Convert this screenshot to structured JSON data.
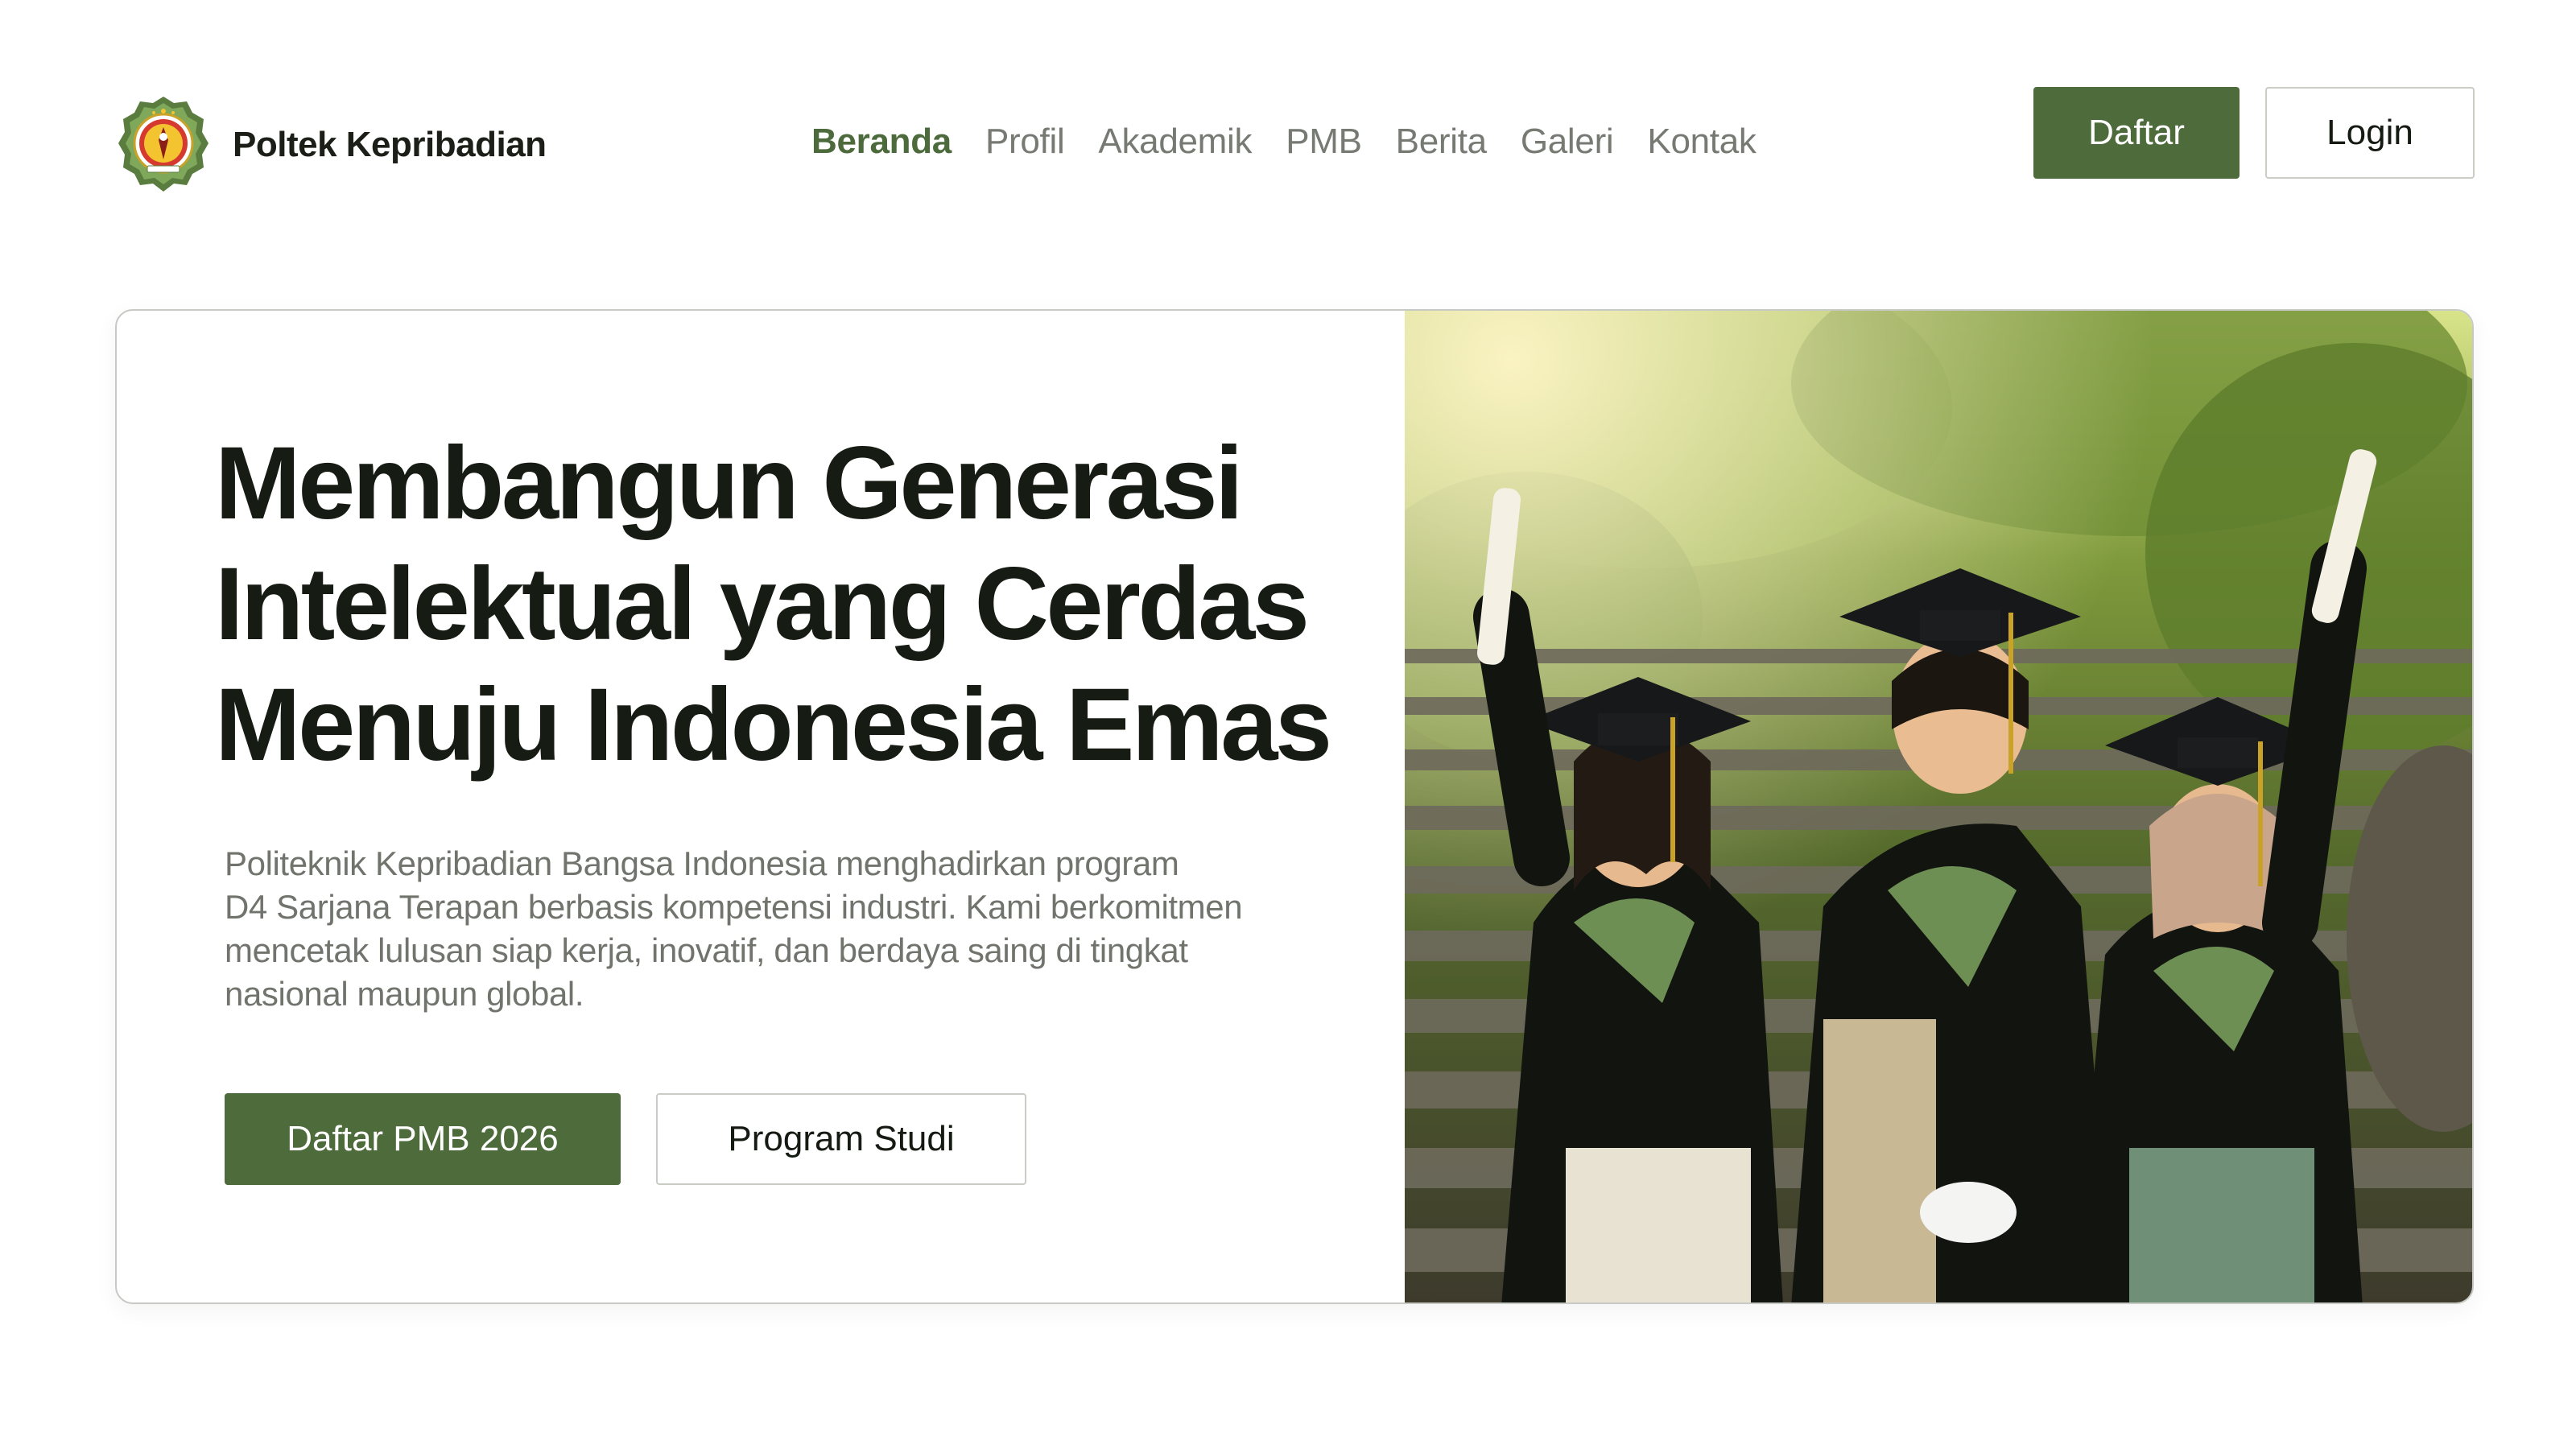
{
  "header": {
    "brand_name": "Poltek Kepribadian",
    "logo_icon": "institution-crest-icon",
    "nav": [
      {
        "label": "Beranda",
        "active": true
      },
      {
        "label": "Profil",
        "active": false
      },
      {
        "label": "Akademik",
        "active": false
      },
      {
        "label": "PMB",
        "active": false
      },
      {
        "label": "Berita",
        "active": false
      },
      {
        "label": "Galeri",
        "active": false
      },
      {
        "label": "Kontak",
        "active": false
      }
    ],
    "register_label": "Daftar",
    "login_label": "Login"
  },
  "hero": {
    "headline_lines": [
      "Membangun Generasi",
      "Intelektual yang Cerdas",
      "Menuju Indonesia Emas"
    ],
    "description_lines": [
      "Politeknik Kepribadian Bangsa Indonesia menghadirkan program",
      "D4 Sarjana Terapan berbasis kompetensi industri. Kami berkomitmen",
      "mencetak lulusan siap kerja, inovatif, dan berdaya saing di tingkat",
      "nasional maupun global."
    ],
    "primary_cta": "Daftar PMB 2026",
    "secondary_cta": "Program Studi",
    "photo_subject": "graduates-photo"
  },
  "colors": {
    "accent": "#4e6b3c",
    "text_dark": "#161c13",
    "text_muted": "#70746d",
    "nav_muted": "#767a73",
    "border": "#c7c9c5",
    "background": "#ffffff"
  }
}
